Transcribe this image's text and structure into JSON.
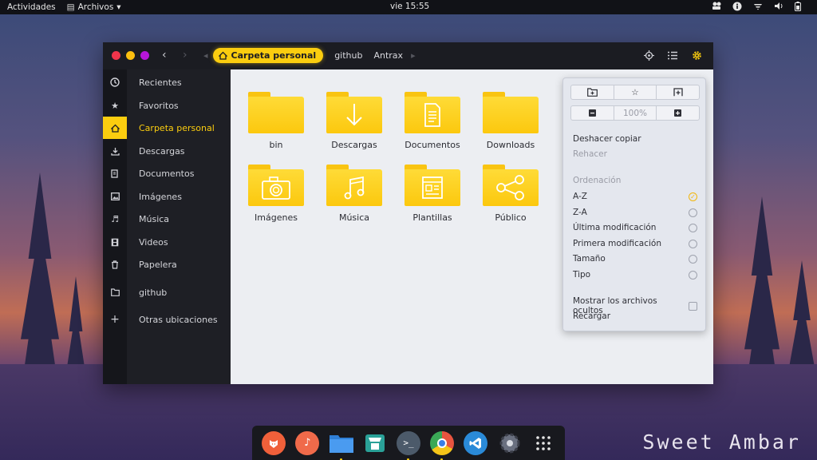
{
  "topbar": {
    "activities": "Actividades",
    "app_menu": "Archivos",
    "clock": "vie 15:55",
    "tray_icons": [
      "people-icon",
      "accessibility-icon",
      "wifi-icon",
      "volume-icon",
      "battery-icon"
    ]
  },
  "window": {
    "controls": [
      "close",
      "minimize",
      "maximize"
    ],
    "breadcrumbs": {
      "current": "Carpeta personal",
      "others": [
        "github",
        "Antrax"
      ]
    },
    "header_icons": [
      "locate-icon",
      "list-view-icon",
      "gear-icon"
    ]
  },
  "sidebar": {
    "items": [
      {
        "label": "Recientes",
        "icon": "clock-icon"
      },
      {
        "label": "Favoritos",
        "icon": "star-icon"
      },
      {
        "label": "Carpeta personal",
        "icon": "home-icon",
        "selected": true
      },
      {
        "label": "Descargas",
        "icon": "download-icon"
      },
      {
        "label": "Documentos",
        "icon": "document-icon"
      },
      {
        "label": "Imágenes",
        "icon": "image-icon"
      },
      {
        "label": "Música",
        "icon": "music-icon"
      },
      {
        "label": "Videos",
        "icon": "film-icon"
      },
      {
        "label": "Papelera",
        "icon": "trash-icon"
      },
      {
        "label": "github",
        "icon": "folder-icon"
      },
      {
        "label": "Otras ubicaciones",
        "icon": "plus-icon"
      }
    ]
  },
  "folders": [
    {
      "label": "bin",
      "emblem": "none"
    },
    {
      "label": "Descargas",
      "emblem": "download"
    },
    {
      "label": "Documentos",
      "emblem": "document"
    },
    {
      "label": "Downloads",
      "emblem": "none"
    },
    {
      "label": "Imágenes",
      "emblem": "camera"
    },
    {
      "label": "Música",
      "emblem": "music"
    },
    {
      "label": "Plantillas",
      "emblem": "template"
    },
    {
      "label": "Público",
      "emblem": "share"
    }
  ],
  "popover": {
    "zoom": "100%",
    "undo": "Deshacer copiar",
    "redo": "Rehacer",
    "sort_heading": "Ordenación",
    "sort_options": [
      {
        "label": "A-Z",
        "selected": true
      },
      {
        "label": "Z-A",
        "selected": false
      },
      {
        "label": "Última modificación",
        "selected": false
      },
      {
        "label": "Primera modificación",
        "selected": false
      },
      {
        "label": "Tamaño",
        "selected": false
      },
      {
        "label": "Tipo",
        "selected": false
      }
    ],
    "show_hidden": "Mostrar los archivos ocultos",
    "reload": "Recargar"
  },
  "dock": {
    "apps": [
      {
        "name": "firefox-icon",
        "color": "#f0603a",
        "running": false
      },
      {
        "name": "music-player-icon",
        "color": "#f06a4a",
        "running": false
      },
      {
        "name": "files-icon",
        "color": "#3d8fe0",
        "running": true
      },
      {
        "name": "software-center-icon",
        "color": "#2aa198",
        "running": false
      },
      {
        "name": "terminal-icon",
        "color": "#4c5a6a",
        "running": true
      },
      {
        "name": "chrome-icon",
        "color": "#e8543f",
        "running": true
      },
      {
        "name": "vscode-icon",
        "color": "#2a8ad8",
        "running": false
      },
      {
        "name": "settings-icon",
        "color": "#6a7080",
        "running": false
      },
      {
        "name": "app-grid-icon",
        "color": "#18191e",
        "running": false
      }
    ]
  },
  "brand": "Sweet Ambar",
  "colors": {
    "accent": "#fbcd0f",
    "window_header": "#1b1c22",
    "content_bg": "#eceef2"
  }
}
